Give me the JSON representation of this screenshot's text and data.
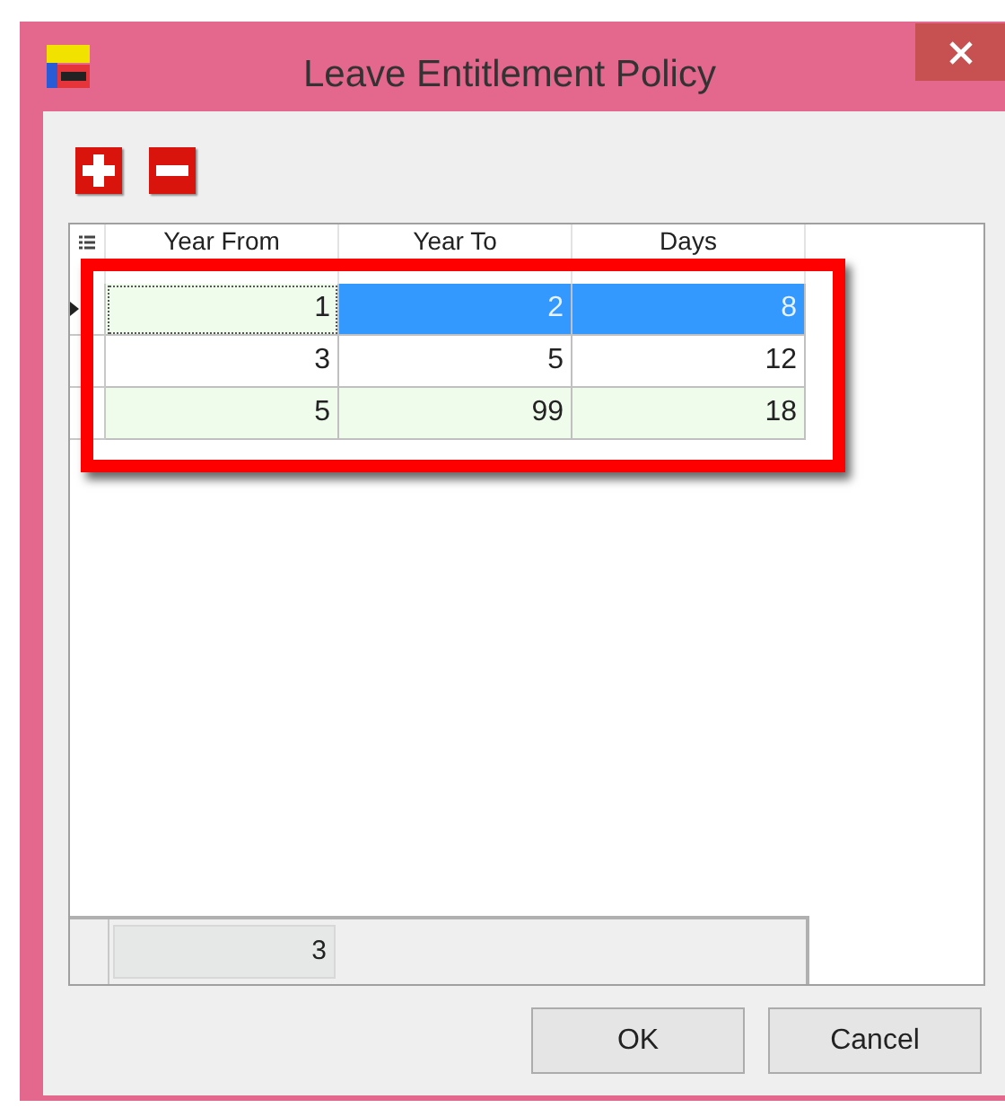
{
  "window": {
    "title": "Leave Entitlement Policy"
  },
  "toolbar": {
    "buttons": [
      {
        "kind": "add"
      },
      {
        "kind": "remove"
      }
    ]
  },
  "grid": {
    "columns": [
      "Year From",
      "Year To",
      "Days"
    ],
    "rows": [
      {
        "current": true,
        "cells": [
          {
            "text": "1",
            "selected": false,
            "focused": true
          },
          {
            "text": "2",
            "selected": true,
            "focused": false
          },
          {
            "text": "8",
            "selected": true,
            "focused": false
          }
        ]
      },
      {
        "current": false,
        "cells": [
          {
            "text": "3",
            "selected": false,
            "focused": false
          },
          {
            "text": "5",
            "selected": false,
            "focused": false
          },
          {
            "text": "12",
            "selected": false,
            "focused": false
          }
        ]
      },
      {
        "current": false,
        "cells": [
          {
            "text": "5",
            "selected": false,
            "focused": false
          },
          {
            "text": "99",
            "selected": false,
            "focused": false
          },
          {
            "text": "18",
            "selected": false,
            "focused": false
          }
        ]
      }
    ],
    "summary": "3"
  },
  "buttons": [
    "OK",
    "Cancel"
  ]
}
